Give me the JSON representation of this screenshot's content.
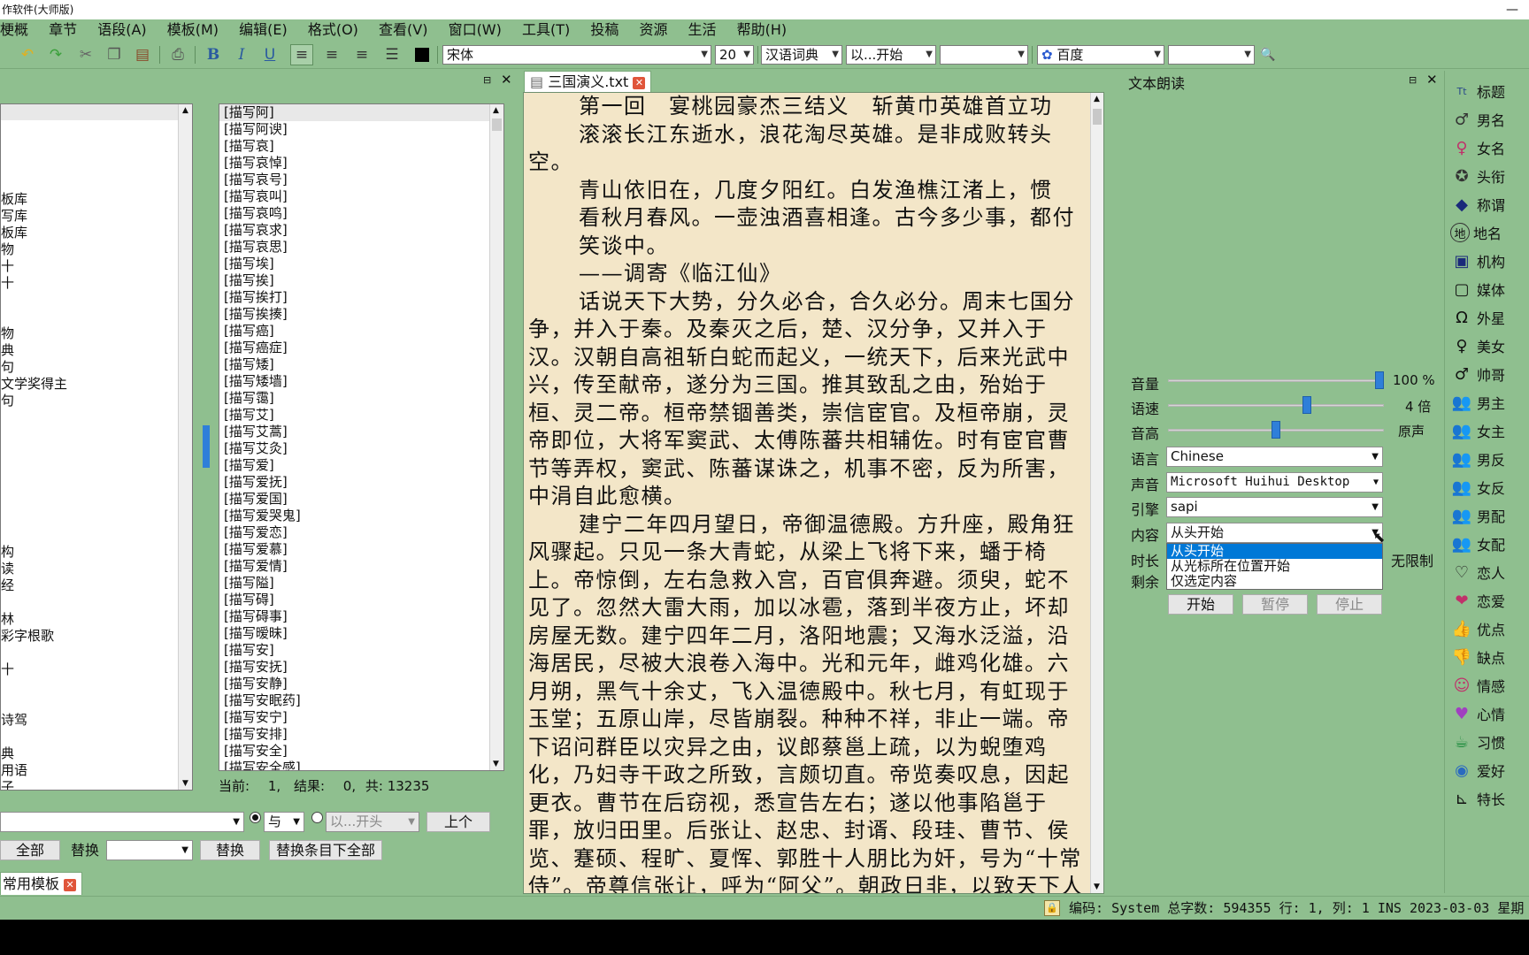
{
  "window": {
    "title": "作软件(大师版)"
  },
  "menu": [
    "梗概",
    "章节",
    "语段(A)",
    "模板(M)",
    "编辑(E)",
    "格式(O)",
    "查看(V)",
    "窗口(W)",
    "工具(T)",
    "投稿",
    "资源",
    "生活",
    "帮助(H)"
  ],
  "toolbar": {
    "font": "宋体",
    "size": "20",
    "dictionary": "汉语词典",
    "match_mode": "以...开始",
    "search_engine": "百度",
    "icons": [
      "undo-icon",
      "redo-icon",
      "cut-icon",
      "copy-icon",
      "paste-icon",
      "print-icon",
      "bold-icon",
      "italic-icon",
      "underline-icon",
      "align-left-icon",
      "align-center-icon",
      "align-right-icon",
      "justify-icon",
      "color-icon"
    ],
    "bold": "B",
    "italic": "I",
    "underline": "U"
  },
  "outline_items": [
    "板库",
    "写库",
    "板库",
    "物",
    "十",
    "十",
    "物",
    "典",
    "句",
    "文学奖得主",
    "句",
    "构",
    "读",
    "经",
    "林",
    "彩字根歌",
    "十",
    "诗驾",
    "典",
    "用语",
    "子"
  ],
  "template_list": [
    "[描写阿]",
    "[描写阿谀]",
    "[描写哀]",
    "[描写哀悼]",
    "[描写哀号]",
    "[描写哀叫]",
    "[描写哀鸣]",
    "[描写哀求]",
    "[描写哀思]",
    "[描写埃]",
    "[描写挨]",
    "[描写挨打]",
    "[描写挨揍]",
    "[描写癌]",
    "[描写癌症]",
    "[描写矮]",
    "[描写矮墙]",
    "[描写霭]",
    "[描写艾]",
    "[描写艾蒿]",
    "[描写艾灸]",
    "[描写爱]",
    "[描写爱抚]",
    "[描写爱国]",
    "[描写爱哭鬼]",
    "[描写爱恋]",
    "[描写爱慕]",
    "[描写爱情]",
    "[描写隘]",
    "[描写碍]",
    "[描写碍事]",
    "[描写暧昧]",
    "[描写安]",
    "[描写安抚]",
    "[描写安静]",
    "[描写安眠药]",
    "[描写安宁]",
    "[描写安排]",
    "[描写安全]",
    "[描写安全感]"
  ],
  "search_status": {
    "current_label": "当前:",
    "current_value": "1,",
    "result_label": "结果:",
    "result_value": "0,",
    "total_label": "共:",
    "total_value": "13235"
  },
  "search_bar": {
    "relation": "与",
    "match": "以...开头",
    "prev_button": "上个",
    "all_button": "全部",
    "replace_label": "替换",
    "replace_button": "替换",
    "replace_all_button": "替换条目下全部"
  },
  "bottom_tab": "常用模板",
  "editor": {
    "tab": "三国演义.txt",
    "paragraphs": [
      {
        "style": "hang",
        "text": "第一回　宴桃园豪杰三结义　斩黄巾英雄首立功"
      },
      {
        "style": "hang",
        "text": "滚滚长江东逝水，浪花淘尽英雄。是非成败转头"
      },
      {
        "style": "plain",
        "text": "空。"
      },
      {
        "style": "indent",
        "text": "青山依旧在，几度夕阳红。白发渔樵江渚上，惯"
      },
      {
        "style": "hang",
        "text": "看秋月春风。一壶浊酒喜相逢。古今多少事，都付"
      },
      {
        "style": "hang",
        "text": "笑谈中。"
      },
      {
        "style": "hang",
        "text": "——调寄《临江仙》"
      },
      {
        "style": "indent",
        "text": "话说天下大势，分久必合，合久必分。周末七国分争，并入于秦。及秦灭之后，楚、汉分争，又并入于汉。汉朝自高祖斩白蛇而起义，一统天下，后来光武中兴，传至献帝，遂分为三国。推其致乱之由，殆始于桓、灵二帝。桓帝禁锢善类，崇信宦官。及桓帝崩，灵帝即位，大将军窦武、太傅陈蕃共相辅佐。时有宦官曹节等弄权，窦武、陈蕃谋诛之，机事不密，反为所害，中涓自此愈横。"
      },
      {
        "style": "indent",
        "text": "建宁二年四月望日，帝御温德殿。方升座，殿角狂风骤起。只见一条大青蛇，从梁上飞将下来，蟠于椅上。帝惊倒，左右急救入宫，百官俱奔避。须臾，蛇不见了。忽然大雷大雨，加以冰雹，落到半夜方止，坏却房屋无数。建宁四年二月，洛阳地震；又海水泛溢，沿海居民，尽被大浪卷入海中。光和元年，雌鸡化雄。六月朔，黑气十余丈，飞入温德殿中。秋七月，有虹现于玉堂；五原山岸，尽皆崩裂。种种不祥，非止一端。帝下诏问群臣以灾异之由，议郎蔡邕上疏，以为蜺堕鸡化，乃妇寺干政之所致，言颇切直。帝览奏叹息，因起更衣。曹节在后窃视，悉宣告左右；遂以他事陷邕于罪，放归田里。后张让、赵忠、封谞、段珪、曹节、侯览、蹇硕、程旷、夏恽、郭胜十人朋比为奸，号为“十常侍”。帝尊信张让，呼为“阿父”。朝政日非，以致天下人心思乱，盗贼蜂起。"
      }
    ]
  },
  "tts": {
    "title": "文本朗读",
    "volume_label": "音量",
    "volume_value": "100 %",
    "volume_level": 1.0,
    "speed_label": "语速",
    "speed_value": "4 倍",
    "speed_level": 0.65,
    "pitch_label": "音高",
    "pitch_value": "原声",
    "pitch_level": 0.5,
    "language_label": "语言",
    "language": "Chinese",
    "voice_label": "声音",
    "voice": "Microsoft Huihui Desktop",
    "engine_label": "引擎",
    "engine": "sapi",
    "content_label": "内容",
    "content": "从头开始",
    "content_options": [
      "从头开始",
      "从光标所在位置开始",
      "仅选定内容"
    ],
    "duration_label": "时长",
    "duration_value": "无限制",
    "remaining_label": "剩余",
    "start_button": "开始",
    "pause_button": "暂停",
    "stop_button": "停止"
  },
  "tags": [
    {
      "label": "标题",
      "icon": "title-icon"
    },
    {
      "label": "男名",
      "icon": "male-icon"
    },
    {
      "label": "女名",
      "icon": "female-icon"
    },
    {
      "label": "头衔",
      "icon": "ribbon-icon"
    },
    {
      "label": "称谓",
      "icon": "tag-icon"
    },
    {
      "label": "地名",
      "icon": "place-icon"
    },
    {
      "label": "机构",
      "icon": "building-icon"
    },
    {
      "label": "媒体",
      "icon": "media-icon"
    },
    {
      "label": "外星",
      "icon": "alien-icon"
    },
    {
      "label": "美女",
      "icon": "woman-icon"
    },
    {
      "label": "帅哥",
      "icon": "man-icon"
    },
    {
      "label": "男主",
      "icon": "male-lead-icon"
    },
    {
      "label": "女主",
      "icon": "female-lead-icon"
    },
    {
      "label": "男反",
      "icon": "male-villain-icon"
    },
    {
      "label": "女反",
      "icon": "female-villain-icon"
    },
    {
      "label": "男配",
      "icon": "male-support-icon"
    },
    {
      "label": "女配",
      "icon": "female-support-icon"
    },
    {
      "label": "恋人",
      "icon": "heart-icon"
    },
    {
      "label": "恋爱",
      "icon": "love-icon"
    },
    {
      "label": "优点",
      "icon": "thumbs-up-icon"
    },
    {
      "label": "缺点",
      "icon": "thumbs-down-icon"
    },
    {
      "label": "情感",
      "icon": "emotion-icon"
    },
    {
      "label": "心情",
      "icon": "mood-icon"
    },
    {
      "label": "习惯",
      "icon": "habit-icon"
    },
    {
      "label": "爱好",
      "icon": "hobby-icon"
    },
    {
      "label": "特长",
      "icon": "skill-icon"
    }
  ],
  "status": {
    "encoding_label": "编码:",
    "encoding": "System",
    "chars_label": "总字数:",
    "chars": "594355",
    "row_label": "行:",
    "row": "1,",
    "col_label": "列:",
    "col": "1",
    "mode": "INS",
    "date": "2023-03-03",
    "weekday": "星期"
  }
}
